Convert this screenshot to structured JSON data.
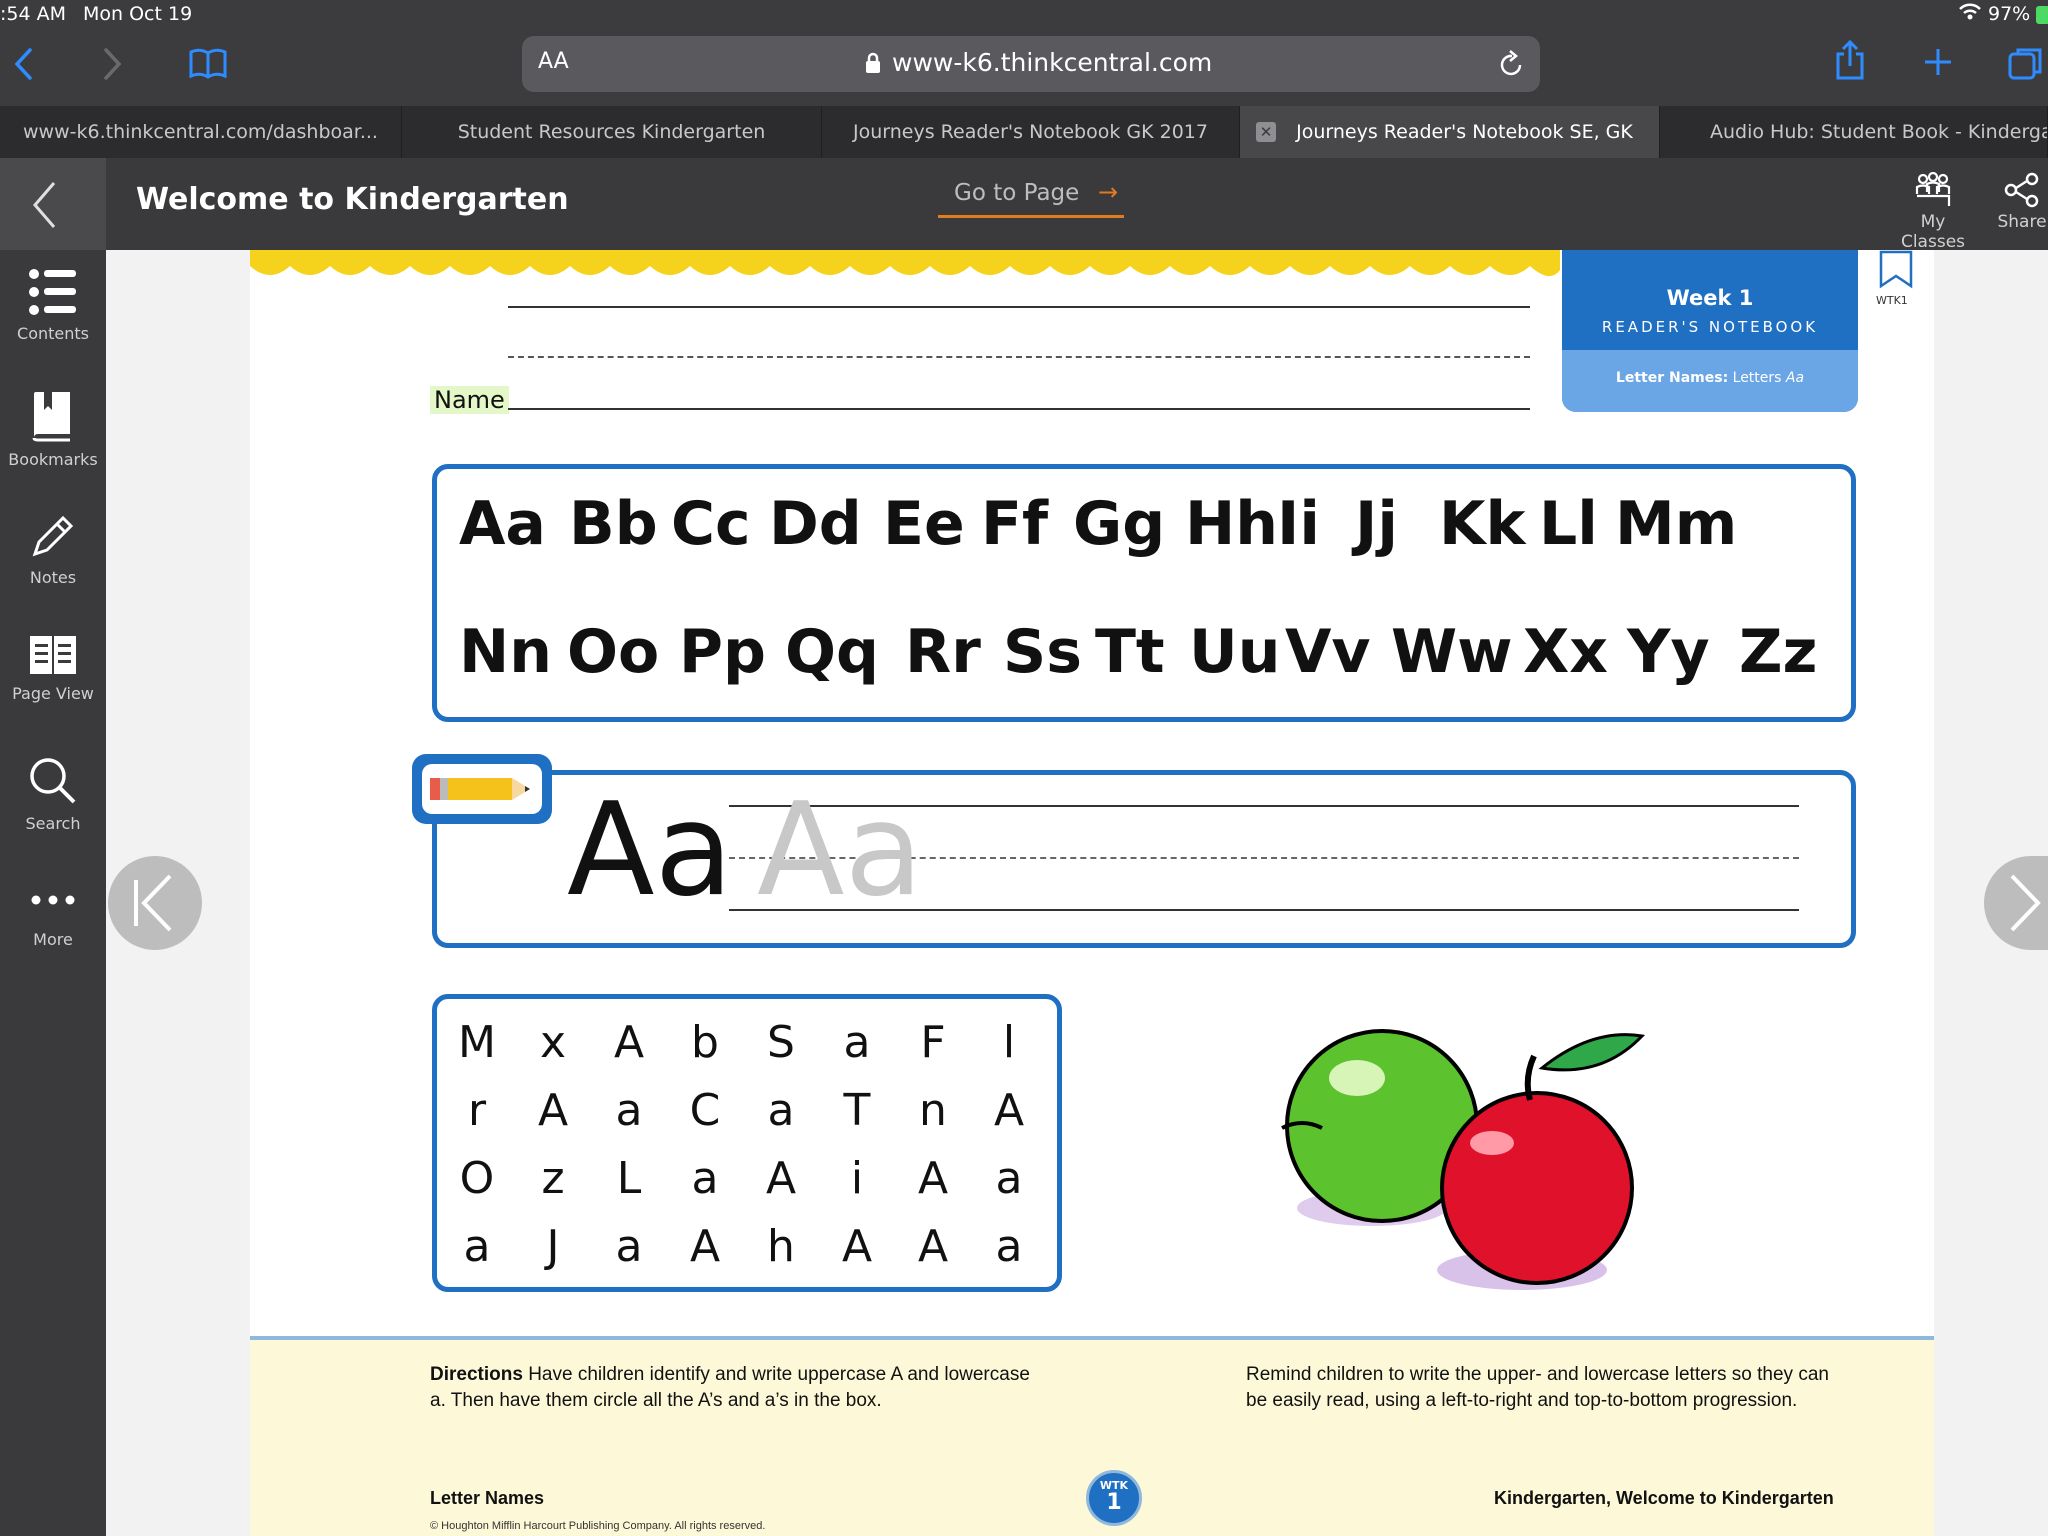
{
  "status": {
    "time": ":54 AM",
    "date": "Mon Oct 19",
    "battery": "97%"
  },
  "browser": {
    "font_size_label": "AA",
    "url": "www-k6.thinkcentral.com"
  },
  "tabs": [
    {
      "label": "www-k6.thinkcentral.com/dashboar..."
    },
    {
      "label": "Student Resources Kindergarten"
    },
    {
      "label": "Journeys Reader's Notebook GK 2017"
    },
    {
      "label": "Journeys Reader's Notebook SE, GK"
    },
    {
      "label": "Audio Hub: Student Book - Kinderga..."
    }
  ],
  "header": {
    "title": "Welcome to Kindergarten",
    "goto_page": "Go to Page",
    "my_classes": "My Classes",
    "share": "Share"
  },
  "sidebar": {
    "items": [
      {
        "label": "Contents"
      },
      {
        "label": "Bookmarks"
      },
      {
        "label": "Notes"
      },
      {
        "label": "Page View"
      },
      {
        "label": "Search"
      },
      {
        "label": "More"
      }
    ]
  },
  "worksheet": {
    "name_label": "Name",
    "week": "Week 1",
    "notebook": "READER'S NOTEBOOK",
    "subtitle_bold": "Letter Names:",
    "subtitle_rest": "Letters",
    "subtitle_italic": "Aa",
    "bookmark_label": "WTK1",
    "alphabet_row1": [
      "Aa",
      "Bb",
      "Cc",
      "Dd",
      "Ee",
      "Ff",
      "Gg",
      "Hh",
      "Ii",
      "Jj",
      "Kk",
      "Ll",
      "Mm"
    ],
    "alphabet_row2": [
      "Nn",
      "Oo",
      "Pp",
      "Qq",
      "Rr",
      "Ss",
      "Tt",
      "Uu",
      "Vv",
      "Ww",
      "Xx",
      "Yy",
      "Zz"
    ],
    "practice_letter": "Aa",
    "practice_trace": "Aa",
    "letter_grid": [
      [
        "M",
        "x",
        "A",
        "b",
        "S",
        "a",
        "F",
        "l"
      ],
      [
        "r",
        "A",
        "a",
        "C",
        "a",
        "T",
        "n",
        "A"
      ],
      [
        "O",
        "z",
        "L",
        "a",
        "A",
        "i",
        "A",
        "a"
      ],
      [
        "a",
        "J",
        "a",
        "A",
        "h",
        "A",
        "A",
        "a"
      ]
    ],
    "directions_bold": "Directions",
    "directions_text": "Have children identify and write uppercase A and lowercase a. Then have them circle all the A’s and a’s in the box.",
    "remind_text": "Remind children to write the upper- and lowercase letters so they can be easily read, using a left-to-right and top-to-bottom progression.",
    "footer_left": "Letter Names",
    "footer_badge_top": "WTK",
    "footer_badge_num": "1",
    "footer_right": "Kindergarten, Welcome to Kindergarten",
    "copyright": "© Houghton Mifflin Harcourt Publishing Company. All rights reserved."
  },
  "colors": {
    "accent": "#1f6fc2",
    "goto_underline": "#e07b1f",
    "footer_bg": "#fdf8d8"
  }
}
